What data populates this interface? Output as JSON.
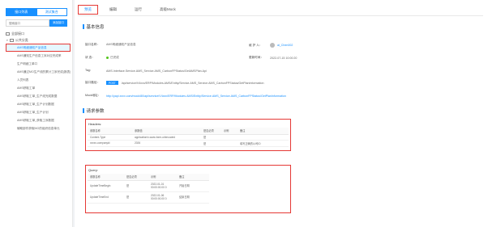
{
  "sidebar": {
    "tabs": [
      "接口列表",
      "测试集合"
    ],
    "search_placeholder": "搜索接口",
    "search_button": "添加接口",
    "root": "全部接口",
    "group": "公共分类",
    "items": [
      "AMS明细通知产品信息",
      "AMS通知生产信息工序对应完成率",
      "生产明细工单口",
      "AMS通过MO生产线的累计工序完成(报表)",
      "人员列表",
      "AMS获取工单",
      "AMS获取工单_生产线完成数据",
      "AMS获取工单_生产计划数据",
      "AMS获取工单_生产计划",
      "AMS获取工单_获取工序数据",
      "辅助部件获取MO的组织信息单元"
    ]
  },
  "top_tabs": [
    "预览",
    "编辑",
    "运行",
    "高级Mock"
  ],
  "basic_info": {
    "title": "基本信息",
    "name_label": "接口名称：",
    "name_value": "AMS明细通知产品信息",
    "maintainer_label": "维 护 人：",
    "maintainer_value": "ai_Chen002",
    "status_label": "状    态：",
    "status_value": "已完成",
    "updated_label": "更新时间：",
    "updated_value": "2022-07-15 10:00:20",
    "tag_label": "Tag：",
    "tag_value": "AMS.Interface.Service.AMS_Service.AMS_CarbonFPStatus/GetAMSPlan.Api",
    "path_label": "接口路径：",
    "path_method": "POST",
    "path_value": "/api/service/V4xxx/ERP/Modules.AMS/Entity/Service.AMS_Service.AMS_CarbonFPStatus/GetPlanInformation",
    "mock_label": "Mock地址：",
    "mock_value": "http://yapi.xxxx.com/mock/80/api/service/V4xxx/ERP/Modules.AMS/Entity/Service.AMS_Service.AMS_CarbonFPStatus/GetPlanInformation"
  },
  "request": {
    "title": "请求参数",
    "headers": {
      "title": "Headers:",
      "columns": [
        "参数名称",
        "参数值",
        "是否必须",
        "示例",
        "备注"
      ],
      "rows": [
        [
          "Content-Type",
          "application/x-www-form-urlencoded",
          "是",
          "",
          ""
        ],
        [
          "xxxxx-companyid",
          "2026",
          "是",
          "",
          "填写正确的公司ID"
        ]
      ]
    },
    "query": {
      "title": "Query:",
      "columns": [
        "参数名称",
        "是否必须",
        "示例",
        "备注"
      ],
      "rows": [
        [
          "UpdateTimeBegin",
          "是",
          "2022-01-01 00:00:00.00 0",
          "开始日期"
        ],
        [
          "UpdateTimeEnd",
          "是",
          "2022-01-06 00:00:00.00 0",
          "结束日期"
        ]
      ]
    }
  }
}
